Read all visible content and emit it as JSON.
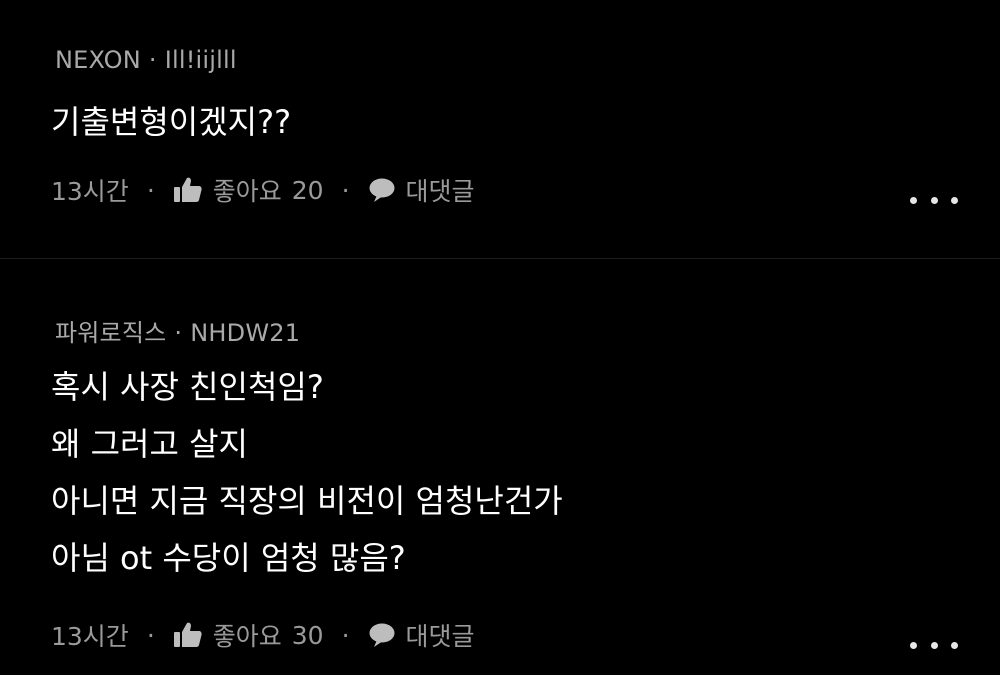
{
  "comments": [
    {
      "source": "NEXON",
      "separator": "·",
      "author": "Ill!iijlll",
      "lines": [
        "기출변형이겠지??"
      ],
      "time": "13시간",
      "like_label": "좋아요",
      "like_count": "20",
      "reply_label": "대댓글"
    },
    {
      "source": "파워로직스",
      "separator": "·",
      "author": "NHDW21",
      "lines": [
        "혹시 사장 친인척임?",
        "왜 그러고 살지",
        "아니면 지금 직장의 비전이 엄청난건가",
        "아님 ot 수당이 엄청 많음?"
      ],
      "time": "13시간",
      "like_label": "좋아요",
      "like_count": "30",
      "reply_label": "대댓글"
    }
  ],
  "action_separator": "·",
  "icons": {
    "like": "thumbs-up-icon",
    "reply": "speech-bubble-icon",
    "more": "more-dots-icon"
  },
  "colors": {
    "background": "#000000",
    "meta_text": "#a9a9a9",
    "body_text": "#ffffff",
    "action_text": "#9a9a9a",
    "divider": "#1c1c1c"
  }
}
